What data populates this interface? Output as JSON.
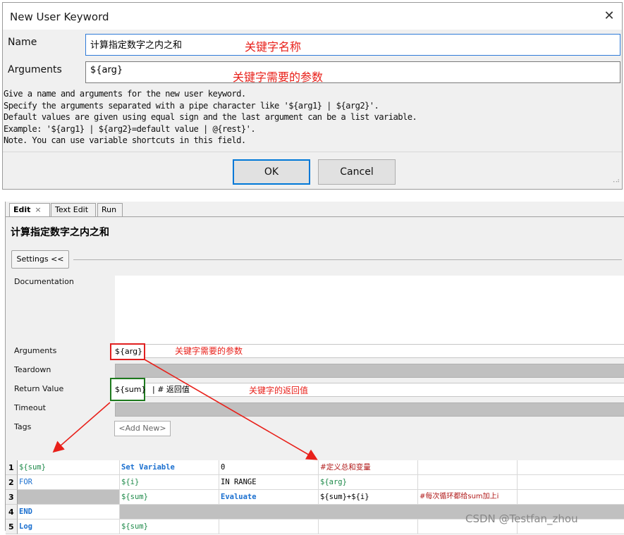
{
  "dialog": {
    "title": "New User Keyword",
    "close_glyph": "✕",
    "name_label": "Name",
    "name_value": "计算指定数字之内之和",
    "name_annotation": "关键字名称",
    "arguments_label": "Arguments",
    "arguments_value": "${arg}",
    "arguments_annotation": "关键字需要的参数",
    "help_text": "Give a name and arguments for the new user keyword.\nSpecify the arguments separated with a pipe character like '${arg1} | ${arg2}'.\nDefault values are given using equal sign and the last argument can be a list variable.\nExample: '${arg1} | ${arg2}=default value | @{rest}'.\nNote. You can use variable shortcuts in this field.",
    "ok_label": "OK",
    "cancel_label": "Cancel"
  },
  "editor": {
    "tabs": [
      {
        "label": "Edit",
        "close": "×"
      },
      {
        "label": "Text Edit"
      },
      {
        "label": "Run"
      }
    ],
    "keyword_title": "计算指定数字之内之和",
    "settings_button": "Settings <<",
    "settings": {
      "documentation_label": "Documentation",
      "arguments_label": "Arguments",
      "arguments_value": "${arg}",
      "arguments_annotation": "关键字需要的参数",
      "teardown_label": "Teardown",
      "return_label": "Return Value",
      "return_value": "${sum}",
      "return_comment": "| # 返回值",
      "return_annotation": "关键字的返回值",
      "timeout_label": "Timeout",
      "tags_label": "Tags",
      "add_new": "<Add New>"
    },
    "grid_rows": [
      {
        "num": "1",
        "cells": [
          "${sum}",
          "Set Variable",
          "0",
          "#定义总和变量",
          "",
          ""
        ]
      },
      {
        "num": "2",
        "cells": [
          "FOR",
          "${i}",
          "IN RANGE",
          "${arg}",
          "",
          ""
        ]
      },
      {
        "num": "3",
        "cells": [
          "",
          "${sum}",
          "Evaluate",
          "${sum}+${i}",
          "#每次循环都给sum加上i",
          ""
        ]
      },
      {
        "num": "4",
        "cells": [
          "END",
          "",
          "",
          "",
          "",
          ""
        ]
      },
      {
        "num": "5",
        "cells": [
          "Log",
          "${sum}",
          "",
          "",
          "",
          ""
        ]
      }
    ]
  },
  "watermark": "CSDN @Testfan_zhou",
  "colors": {
    "annotation_red": "#e8201a",
    "keyword_blue": "#1a6fcf",
    "variable_green": "#1e8a4a",
    "comment_red": "#b01818",
    "ok_focus": "#0078d7"
  }
}
